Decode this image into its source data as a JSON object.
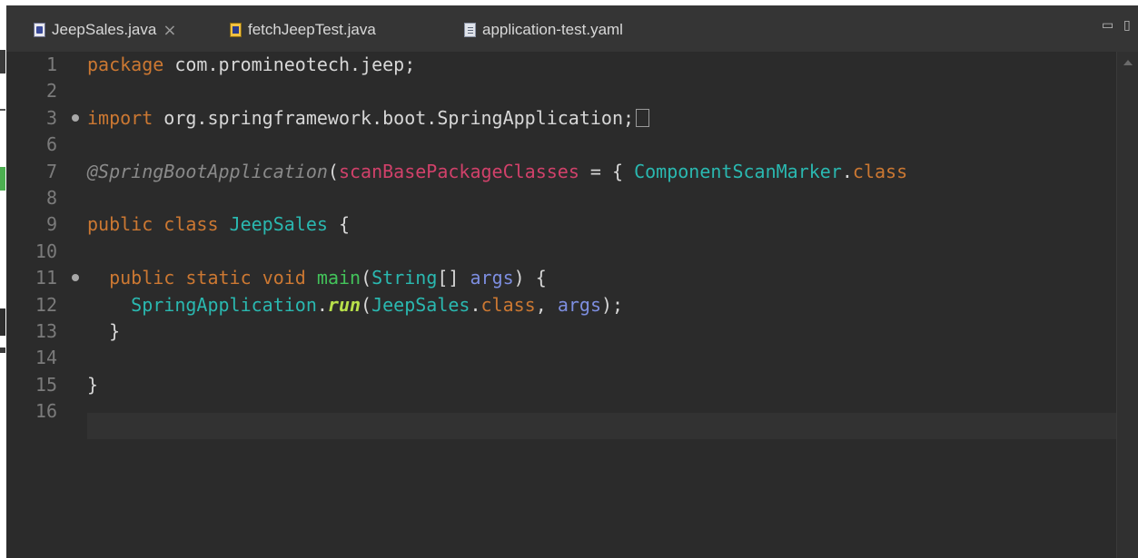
{
  "tabs": [
    {
      "label": "JeepSales.java",
      "icon": "java-file-icon",
      "active": true,
      "close": "×"
    },
    {
      "label": "fetchJeepTest.java",
      "icon": "java-test-file-icon",
      "active": false
    },
    {
      "label": "application-test.yaml",
      "icon": "yaml-file-icon",
      "active": false
    }
  ],
  "window_controls": {
    "minimize": "▭",
    "maximize": "▯"
  },
  "editor": {
    "lines": [
      {
        "n": "1",
        "tokens": [
          {
            "t": "package",
            "c": "t-kw"
          },
          {
            "t": " com.promineotech.jeep;",
            "c": "t-pk"
          }
        ]
      },
      {
        "n": "2",
        "tokens": []
      },
      {
        "n": "3",
        "fold": true,
        "tokens": [
          {
            "t": "import",
            "c": "t-kw"
          },
          {
            "t": " org.springframework.boot.SpringApplication;",
            "c": "t-pk"
          }
        ],
        "collapsed": true
      },
      {
        "n": "6",
        "tokens": []
      },
      {
        "n": "7",
        "tokens": [
          {
            "t": "@SpringBootApplication",
            "c": "t-an"
          },
          {
            "t": "(",
            "c": "t-pk"
          },
          {
            "t": "scanBasePackageClasses",
            "c": "t-attr"
          },
          {
            "t": " = { ",
            "c": "t-pk"
          },
          {
            "t": "ComponentScanMarker",
            "c": "t-cls"
          },
          {
            "t": ".",
            "c": "t-pk"
          },
          {
            "t": "class",
            "c": "t-kw"
          }
        ]
      },
      {
        "n": "8",
        "tokens": []
      },
      {
        "n": "9",
        "tokens": [
          {
            "t": "public",
            "c": "t-kw"
          },
          {
            "t": " ",
            "c": "t-pk"
          },
          {
            "t": "class",
            "c": "t-kw"
          },
          {
            "t": " ",
            "c": "t-pk"
          },
          {
            "t": "JeepSales",
            "c": "t-cls"
          },
          {
            "t": " {",
            "c": "t-pk"
          }
        ]
      },
      {
        "n": "10",
        "tokens": []
      },
      {
        "n": "11",
        "fold": true,
        "tokens": [
          {
            "t": "  ",
            "c": "t-pk"
          },
          {
            "t": "public",
            "c": "t-kw"
          },
          {
            "t": " ",
            "c": "t-pk"
          },
          {
            "t": "static",
            "c": "t-kw"
          },
          {
            "t": " ",
            "c": "t-pk"
          },
          {
            "t": "void",
            "c": "t-kw"
          },
          {
            "t": " ",
            "c": "t-pk"
          },
          {
            "t": "main",
            "c": "t-meth"
          },
          {
            "t": "(",
            "c": "t-pk"
          },
          {
            "t": "String",
            "c": "t-cls"
          },
          {
            "t": "[] ",
            "c": "t-pk"
          },
          {
            "t": "args",
            "c": "t-param"
          },
          {
            "t": ") {",
            "c": "t-pk"
          }
        ]
      },
      {
        "n": "12",
        "tokens": [
          {
            "t": "    ",
            "c": "t-pk"
          },
          {
            "t": "SpringApplication",
            "c": "t-cls"
          },
          {
            "t": ".",
            "c": "t-pk"
          },
          {
            "t": "run",
            "c": "t-stat"
          },
          {
            "t": "(",
            "c": "t-pk"
          },
          {
            "t": "JeepSales",
            "c": "t-cls"
          },
          {
            "t": ".",
            "c": "t-pk"
          },
          {
            "t": "class",
            "c": "t-kw"
          },
          {
            "t": ", ",
            "c": "t-pk"
          },
          {
            "t": "args",
            "c": "t-param"
          },
          {
            "t": ");",
            "c": "t-pk"
          }
        ]
      },
      {
        "n": "13",
        "tokens": [
          {
            "t": "  }",
            "c": "t-pk"
          }
        ]
      },
      {
        "n": "14",
        "tokens": []
      },
      {
        "n": "15",
        "tokens": [
          {
            "t": "}",
            "c": "t-pk"
          }
        ]
      },
      {
        "n": "16",
        "tokens": [],
        "current": true
      }
    ]
  },
  "colors": {
    "editor_bg": "#2b2b2b",
    "tabbar_bg": "#353535",
    "keyword": "#cc7832",
    "annotation": "#8a8a8a",
    "attribute": "#d1416a",
    "class": "#2ab8b0",
    "method": "#43c35a",
    "parameter": "#7d8ee0",
    "static_call": "#b8e04a"
  }
}
